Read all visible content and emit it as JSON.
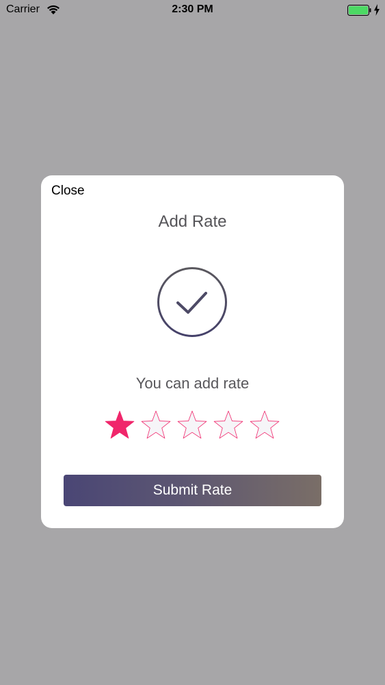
{
  "status_bar": {
    "carrier": "Carrier",
    "time": "2:30 PM",
    "battery_color": "#4cd964"
  },
  "modal": {
    "close_label": "Close",
    "title": "Add Rate",
    "message": "You can add rate",
    "rating": {
      "value": 1,
      "max": 5
    },
    "submit_label": "Submit Rate",
    "star_color": "#f0266b",
    "check_color": "#4d4a66",
    "submit_gradient": [
      "#4a4675",
      "#7a6e67"
    ]
  }
}
